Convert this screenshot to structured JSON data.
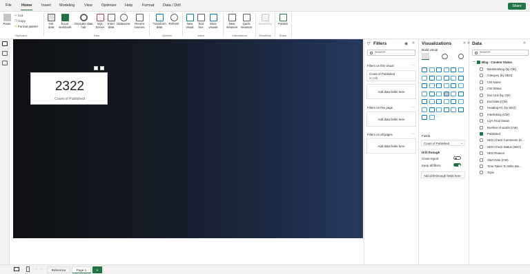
{
  "menu": {
    "items": [
      "File",
      "Home",
      "Insert",
      "Modeling",
      "View",
      "Optimize",
      "Help",
      "Format",
      "Data / Drill"
    ],
    "share_label": "Share"
  },
  "ribbon": {
    "clipboard": {
      "paste": "Paste",
      "cut": "Cut",
      "copy": "Copy",
      "format_painter": "Format painter",
      "group": "Clipboard"
    },
    "data": {
      "get_data": "Get data",
      "excel": "Excel workbook",
      "onelake": "OneLake data hub",
      "sql": "SQL Server",
      "enter": "Enter data",
      "dataverse": "Dataverse",
      "recent": "Recent sources",
      "group": "Data"
    },
    "queries": {
      "transform": "Transform data",
      "refresh": "Refresh",
      "group": "Queries"
    },
    "insert": {
      "new_visual": "New visual",
      "text_box": "Text box",
      "more_visuals": "More visuals",
      "group": "Insert"
    },
    "calculations": {
      "new_measure": "New measure",
      "quick_measure": "Quick measure",
      "group": "Calculations"
    },
    "sensitivity": {
      "label": "Sensitivity",
      "group": "Sensitivity"
    },
    "share": {
      "publish": "Publish",
      "group": "Share"
    }
  },
  "card": {
    "value": "2322",
    "label": "Count of Published"
  },
  "pages": {
    "reference": "Reference",
    "page1": "Page 1",
    "add": "+"
  },
  "filters": {
    "title": "Filters",
    "search_placeholder": "Search",
    "on_visual": "Filters on this visual",
    "visual_filter_name": "Count of Published",
    "visual_filter_value": "is (All)",
    "add_fields": "Add data fields here",
    "on_page": "Filters on this page",
    "on_all": "Filters on all pages"
  },
  "viz": {
    "title": "Visualizations",
    "build_visual": "Build visual",
    "fields_label": "Fields",
    "field_value": "Count of Published",
    "drill_through": "Drill through",
    "cross_report": "Cross-report",
    "cross_report_state": "Off",
    "keep_filters": "Keep all filters",
    "keep_filters_state": "On",
    "add_drill": "Add drill-through fields here"
  },
  "data": {
    "title": "Data",
    "search_placeholder": "Search",
    "table": "Blog - Content Status",
    "fields": [
      {
        "label": "Bookmarking (by CW)",
        "checked": false
      },
      {
        "label": "Category (by SEO)",
        "checked": false
      },
      {
        "label": "CW Name",
        "checked": false
      },
      {
        "label": "CW Status",
        "checked": false
      },
      {
        "label": "Doc Link (by CW)",
        "checked": false
      },
      {
        "label": "End Date (CW)",
        "checked": false
      },
      {
        "label": "Heading-H1 (by SEO)",
        "checked": false
      },
      {
        "label": "Interlinking (CW)",
        "checked": false
      },
      {
        "label": "LQA Final Status",
        "checked": false
      },
      {
        "label": "Number of words (CW)",
        "checked": false
      },
      {
        "label": "Published",
        "checked": true
      },
      {
        "label": "SEO Check Comments (D...",
        "checked": false
      },
      {
        "label": "SEO Check Status (SEO)",
        "checked": false
      },
      {
        "label": "SEO Reason",
        "checked": false
      },
      {
        "label": "Start Date (CW)",
        "checked": false
      },
      {
        "label": "Time Taken To Write Blo...",
        "checked": false
      },
      {
        "label": "Topic",
        "checked": false
      }
    ]
  },
  "colors": {
    "accent": "#217346",
    "canvas_dark": "#0f1114",
    "canvas_blue": "#243a5e"
  }
}
